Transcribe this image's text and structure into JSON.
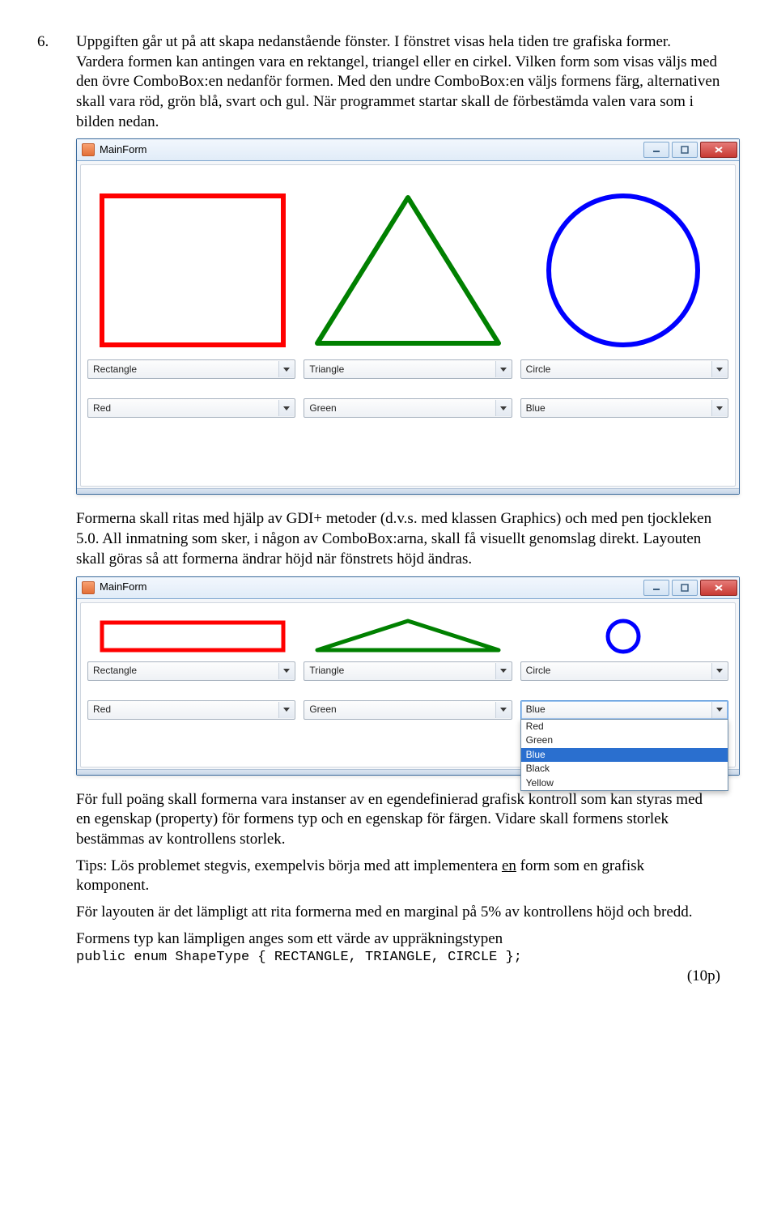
{
  "question_number": "6.",
  "intro_text_1": "Uppgiften går ut på att skapa nedanstående fönster. I fönstret visas hela tiden tre grafiska former. Vardera formen kan antingen vara en rektangel, triangel eller en cirkel. Vilken form som visas väljs med den övre ComboBox:en nedanför formen. Med den undre ComboBox:en väljs formens färg, alternativen skall vara röd, grön blå, svart och gul. När programmet startar skall de förbestämda valen vara som i bilden nedan.",
  "window_title": "MainForm",
  "shape_combo_values": [
    "Rectangle",
    "Triangle",
    "Circle"
  ],
  "color_combo_values": [
    "Red",
    "Green",
    "Blue"
  ],
  "dropdown_options": [
    "Red",
    "Green",
    "Blue",
    "Black",
    "Yellow"
  ],
  "dropdown_selected": "Blue",
  "middle_text": "Formerna skall ritas med hjälp av GDI+ metoder (d.v.s. med klassen Graphics) och med pen tjockleken 5.0. All inmatning som sker, i någon av ComboBox:arna, skall få visuellt genomslag direkt. Layouten skall göras så att formerna ändrar höjd när fönstrets höjd ändras.",
  "end_para_1": "För full poäng skall formerna vara instanser av en egendefinierad grafisk kontroll som kan styras med en egenskap (property) för formens typ och en egenskap för färgen. Vidare skall formens storlek bestämmas av kontrollens storlek.",
  "end_para_2_a": "Tips: Lös problemet stegvis, exempelvis börja med att implementera ",
  "end_para_2_u": "en",
  "end_para_2_b": " form som en grafisk komponent.",
  "end_para_3": "För layouten är det lämpligt att rita formerna med en marginal på 5% av kontrollens höjd och bredd.",
  "end_para_4": "Formens typ kan lämpligen anges som ett värde av uppräkningstypen",
  "code_line": "public enum ShapeType { RECTANGLE, TRIANGLE, CIRCLE };",
  "points": "(10p)"
}
